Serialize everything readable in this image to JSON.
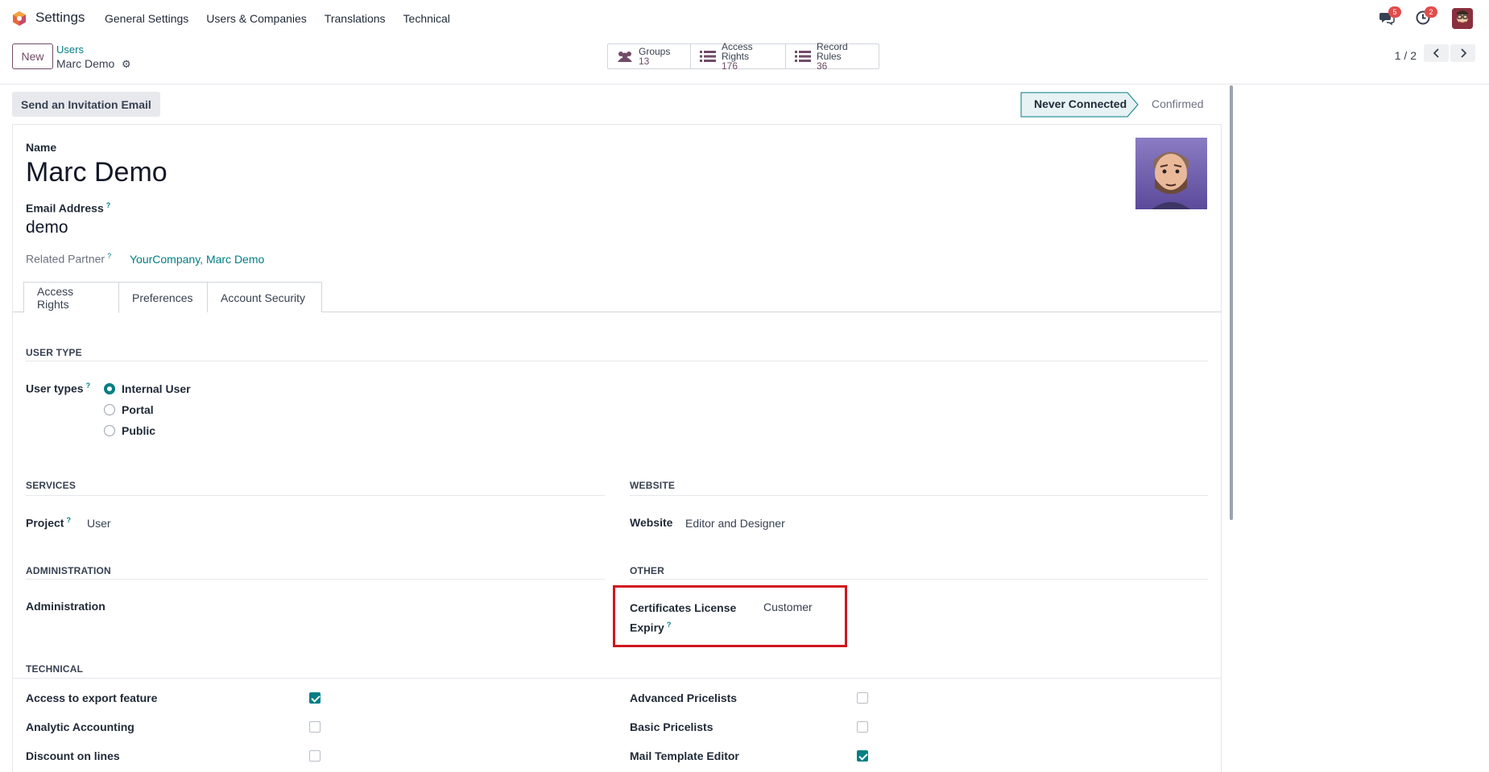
{
  "navbar": {
    "app_name": "Settings",
    "menu": [
      "General Settings",
      "Users & Companies",
      "Translations",
      "Technical"
    ],
    "messages_badge": "5",
    "activities_badge": "2"
  },
  "control": {
    "new_label": "New",
    "breadcrumb_parent": "Users",
    "breadcrumb_current": "Marc Demo",
    "smart_buttons": [
      {
        "label": "Groups",
        "value": "13",
        "icon": "users-icon"
      },
      {
        "label": "Access Rights",
        "value": "176",
        "icon": "list-icon"
      },
      {
        "label": "Record Rules",
        "value": "36",
        "icon": "list-icon"
      }
    ],
    "pager": "1 / 2"
  },
  "statusbar": {
    "invite_label": "Send an Invitation Email",
    "stage_active": "Never Connected",
    "stage_next": "Confirmed"
  },
  "form": {
    "name_label": "Name",
    "name_value": "Marc Demo",
    "email_label": "Email Address",
    "email_value": "demo",
    "partner_label": "Related Partner",
    "partner_value": "YourCompany, Marc Demo",
    "help_mark": "?"
  },
  "tabs": [
    "Access Rights",
    "Preferences",
    "Account Security"
  ],
  "user_type": {
    "section": "USER TYPE",
    "label": "User types",
    "options": [
      "Internal User",
      "Portal",
      "Public"
    ],
    "selected": "Internal User"
  },
  "services": {
    "section": "SERVICES",
    "project_label": "Project",
    "project_value": "User"
  },
  "website": {
    "section": "WEBSITE",
    "label": "Website",
    "value": "Editor and Designer"
  },
  "administration": {
    "section": "ADMINISTRATION",
    "label": "Administration"
  },
  "other": {
    "section": "OTHER",
    "label_line1": "Certificates License",
    "label_line2": "Expiry",
    "value": "Customer"
  },
  "technical": {
    "section": "TECHNICAL",
    "left": [
      {
        "label": "Access to export feature",
        "checked": true
      },
      {
        "label": "Analytic Accounting",
        "checked": false
      },
      {
        "label": "Discount on lines",
        "checked": false
      }
    ],
    "right": [
      {
        "label": "Advanced Pricelists",
        "checked": false
      },
      {
        "label": "Basic Pricelists",
        "checked": false
      },
      {
        "label": "Mail Template Editor",
        "checked": true
      }
    ]
  },
  "colors": {
    "brand": "#714b67",
    "accent": "#017e84",
    "highlight": "#d0161f"
  }
}
